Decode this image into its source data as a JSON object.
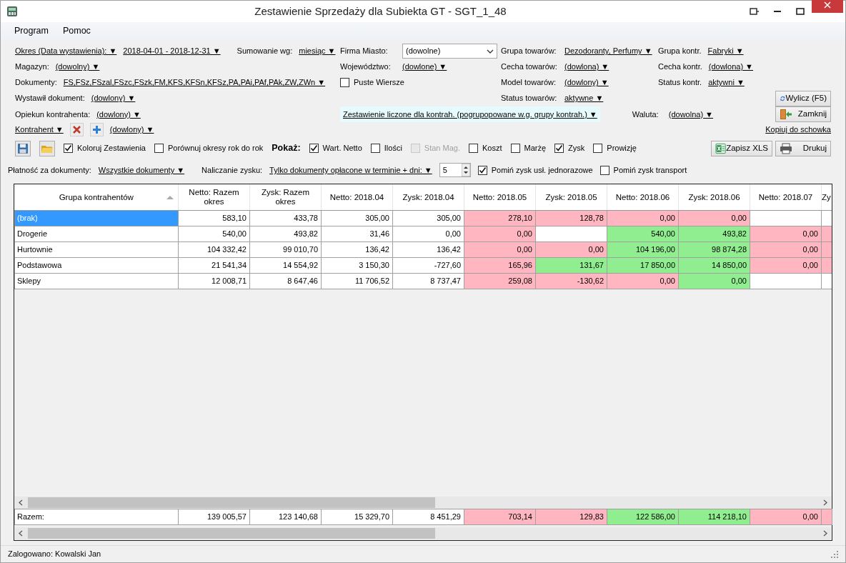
{
  "window": {
    "title": "Zestawienie Sprzedaży dla Subiekta GT - SGT_1_48"
  },
  "menu": [
    {
      "label": "Program"
    },
    {
      "label": "Pomoc"
    }
  ],
  "filter_rows": [
    {
      "main": [
        {
          "kind": "link",
          "text": "Okres (Data wystawienia): ▼"
        },
        {
          "kind": "link",
          "text": "2018-04-01 - 2018-12-31 ▼"
        },
        {
          "kind": "label",
          "text": "Sumowanie wg:"
        },
        {
          "kind": "link",
          "text": "miesiąc ▼"
        }
      ],
      "middle": [
        {
          "kind": "label",
          "text": "Firma Miasto:"
        },
        {
          "kind": "combo",
          "value": "(dowolne)"
        }
      ],
      "goods": [
        {
          "kind": "label",
          "text": "Grupa towarów:"
        },
        {
          "kind": "link",
          "text": "Dezodoranty, Perfumy ▼"
        }
      ],
      "contractor": [
        {
          "kind": "label",
          "text": "Grupa kontr."
        },
        {
          "kind": "link",
          "text": "Fabryki ▼"
        }
      ]
    },
    {
      "main": [
        {
          "kind": "label",
          "text": "Magazyn:"
        },
        {
          "kind": "link",
          "text": "(dowolny) ▼"
        }
      ],
      "middle": [
        {
          "kind": "label",
          "text": "Województwo:"
        },
        {
          "kind": "link",
          "text": "(dowlone) ▼"
        }
      ],
      "goods": [
        {
          "kind": "label",
          "text": "Cecha towarów:"
        },
        {
          "kind": "link",
          "text": "(dowlona) ▼"
        }
      ],
      "contractor": [
        {
          "kind": "label",
          "text": "Cecha kontr."
        },
        {
          "kind": "link",
          "text": "(dowlona) ▼"
        }
      ]
    },
    {
      "main": [
        {
          "kind": "label",
          "text": "Dokumenty:"
        },
        {
          "kind": "link",
          "text": "FS,FSz,FSzal,FSzc,FSzk,FM,KFS,KFSn,KFSz,PA,PAi,PAf,PAk,ZW,ZWn ▼"
        }
      ],
      "middle": [
        {
          "kind": "check",
          "label": "Puste Wiersze",
          "checked": false,
          "disabled": false
        }
      ],
      "goods": [
        {
          "kind": "label",
          "text": "Model towarów:"
        },
        {
          "kind": "link",
          "text": "(dowlony) ▼"
        }
      ],
      "contractor": [
        {
          "kind": "label",
          "text": "Status kontr."
        },
        {
          "kind": "link",
          "text": "aktywni ▼"
        }
      ]
    },
    {
      "main": [
        {
          "kind": "label",
          "text": "Wystawił dokument:"
        },
        {
          "kind": "link",
          "text": "(dowlony) ▼"
        }
      ],
      "goods": [
        {
          "kind": "label",
          "text": "Status towarów:"
        },
        {
          "kind": "link",
          "text": "aktywne ▼"
        }
      ],
      "action": [
        {
          "kind": "button",
          "text": "Wylicz (F5)"
        }
      ]
    },
    {
      "main": [
        {
          "kind": "label",
          "text": "Opiekun kontrahenta:"
        },
        {
          "kind": "link",
          "text": "(dowlony) ▼"
        }
      ],
      "middle": [
        {
          "kind": "highlight-link",
          "text": "Zestawienie liczone dla kontrah. (pogrupopowane w.g. grupy kontrah.) ▼"
        },
        {
          "kind": "label",
          "text": "Waluta:"
        },
        {
          "kind": "link",
          "text": "(dowolna) ▼"
        }
      ],
      "action": [
        {
          "kind": "button",
          "text": "Zamknij"
        }
      ]
    },
    {
      "main": [
        {
          "kind": "link",
          "text": "Kontrahent ▼"
        },
        {
          "kind": "remove"
        },
        {
          "kind": "add"
        },
        {
          "kind": "link",
          "text": "(dowlony) ▼"
        }
      ],
      "action": [
        {
          "kind": "link",
          "text": "Kopiuj do schowka"
        }
      ]
    }
  ],
  "show_row": {
    "items": [
      {
        "kind": "save"
      },
      {
        "kind": "open"
      },
      {
        "kind": "check",
        "label": "Koloruj Zestawienia",
        "checked": true,
        "disabled": false
      },
      {
        "kind": "check",
        "label": "Porównuj okresy rok do rok",
        "checked": false,
        "disabled": false
      },
      {
        "kind": "heading",
        "text": "Pokaż:"
      },
      {
        "kind": "check",
        "label": "Wart. Netto",
        "checked": true,
        "disabled": false
      },
      {
        "kind": "check",
        "label": "Ilości",
        "checked": false,
        "disabled": false
      },
      {
        "kind": "check",
        "label": "Stan Mag.",
        "checked": false,
        "disabled": true
      },
      {
        "kind": "check",
        "label": "Koszt",
        "checked": false,
        "disabled": false
      },
      {
        "kind": "check",
        "label": "Marżę",
        "checked": false,
        "disabled": false
      },
      {
        "kind": "check",
        "label": "Zysk",
        "checked": true,
        "disabled": false
      },
      {
        "kind": "check",
        "label": "Prowizję",
        "checked": false,
        "disabled": false
      }
    ],
    "buttons": [
      {
        "text": "Zapisz XLS"
      },
      {
        "text": "Drukuj"
      }
    ]
  },
  "payment_row": [
    {
      "kind": "label",
      "text": "Płatność za dokumenty:"
    },
    {
      "kind": "link",
      "text": "Wszystkie dokumenty ▼"
    },
    {
      "kind": "label",
      "text": "Naliczanie zysku:"
    },
    {
      "kind": "link",
      "text": "Tylko dokumenty opłacone w terminie + dni: ▼"
    },
    {
      "kind": "spinner",
      "value": "5"
    },
    {
      "kind": "check",
      "label": "Pomiń zysk usł. jednorazowe",
      "checked": true,
      "disabled": false
    },
    {
      "kind": "check",
      "label": "Pomiń zysk transport",
      "checked": false,
      "disabled": false
    }
  ],
  "table": {
    "columns": [
      "Grupa kontrahentów",
      "Netto: Razem okres",
      "Zysk: Razem okres",
      "Netto: 2018.04",
      "Zysk: 2018.04",
      "Netto: 2018.05",
      "Zysk: 2018.05",
      "Netto: 2018.06",
      "Zysk: 2018.06",
      "Netto: 2018.07",
      "Zy"
    ],
    "rows": [
      {
        "selected": true,
        "cells": [
          {
            "text": "(brak)"
          },
          {
            "text": "583,10"
          },
          {
            "text": "433,78"
          },
          {
            "text": "305,00"
          },
          {
            "text": "305,00"
          },
          {
            "text": "278,10",
            "color": "#ffb6c1"
          },
          {
            "text": "128,78",
            "color": "#ffb6c1"
          },
          {
            "text": "0,00",
            "color": "#ffb6c1"
          },
          {
            "text": "0,00",
            "color": "#ffb6c1"
          },
          {},
          {}
        ]
      },
      {
        "selected": false,
        "cells": [
          {
            "text": "Drogerie"
          },
          {
            "text": "540,00"
          },
          {
            "text": "493,82"
          },
          {
            "text": "31,46"
          },
          {
            "text": "0,00"
          },
          {
            "text": "0,00",
            "color": "#ffb6c1"
          },
          {},
          {
            "text": "540,00",
            "color": "#90ee90"
          },
          {
            "text": "493,82",
            "color": "#90ee90"
          },
          {
            "text": "0,00",
            "color": "#ffb6c1"
          },
          {
            "color": "#ffb6c1"
          }
        ]
      },
      {
        "selected": false,
        "cells": [
          {
            "text": "Hurtownie"
          },
          {
            "text": "104 332,42"
          },
          {
            "text": "99 010,70"
          },
          {
            "text": "136,42"
          },
          {
            "text": "136,42"
          },
          {
            "text": "0,00",
            "color": "#ffb6c1"
          },
          {
            "text": "0,00",
            "color": "#ffb6c1"
          },
          {
            "text": "104 196,00",
            "color": "#90ee90"
          },
          {
            "text": "98 874,28",
            "color": "#90ee90"
          },
          {
            "text": "0,00",
            "color": "#ffb6c1"
          },
          {
            "color": "#ffb6c1"
          }
        ]
      },
      {
        "selected": false,
        "cells": [
          {
            "text": "Podstawowa"
          },
          {
            "text": "21 541,34"
          },
          {
            "text": "14 554,92"
          },
          {
            "text": "3 150,30"
          },
          {
            "text": "-727,60"
          },
          {
            "text": "165,96",
            "color": "#ffb6c1"
          },
          {
            "text": "131,67",
            "color": "#90ee90"
          },
          {
            "text": "17 850,00",
            "color": "#90ee90"
          },
          {
            "text": "14 850,00",
            "color": "#90ee90"
          },
          {
            "text": "0,00",
            "color": "#ffb6c1"
          },
          {
            "color": "#ffb6c1"
          }
        ]
      },
      {
        "selected": false,
        "cells": [
          {
            "text": "Sklepy"
          },
          {
            "text": "12 008,71"
          },
          {
            "text": "8 647,46"
          },
          {
            "text": "11 706,52"
          },
          {
            "text": "8 737,47"
          },
          {
            "text": "259,08",
            "color": "#ffb6c1"
          },
          {
            "text": "-130,62",
            "color": "#ffb6c1"
          },
          {
            "text": "0,00",
            "color": "#ffb6c1"
          },
          {
            "text": "0,00",
            "color": "#90ee90"
          },
          {},
          {}
        ]
      }
    ],
    "totals": [
      {
        "text": "Razem:"
      },
      {
        "text": "139 005,57"
      },
      {
        "text": "123 140,68"
      },
      {
        "text": "15 329,70"
      },
      {
        "text": "8 451,29"
      },
      {
        "text": "703,14",
        "color": "#ffb6c1"
      },
      {
        "text": "129,83",
        "color": "#ffb6c1"
      },
      {
        "text": "122 586,00",
        "color": "#90ee90"
      },
      {
        "text": "114 218,10",
        "color": "#90ee90"
      },
      {
        "text": "0,00",
        "color": "#ffb6c1"
      },
      {
        "color": "#ffb6c1"
      }
    ]
  },
  "status_bar": {
    "text": "Zalogowano: Kowalski Jan"
  }
}
